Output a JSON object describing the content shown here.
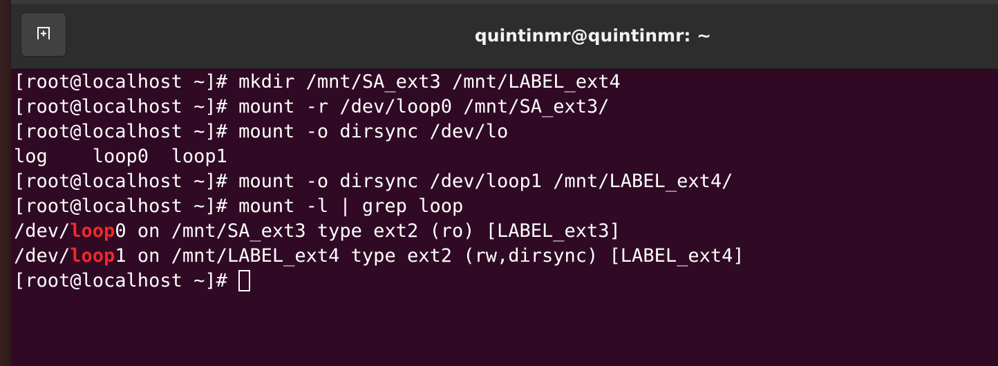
{
  "window": {
    "title": "quintinmr@quintinmr: ~",
    "new_tab_icon": "new-tab-icon"
  },
  "terminal": {
    "prompt": "[root@localhost ~]# ",
    "lines": [
      {
        "type": "command",
        "text": "mkdir /mnt/SA_ext3 /mnt/LABEL_ext4"
      },
      {
        "type": "command",
        "text": "mount -r /dev/loop0 /mnt/SA_ext3/"
      },
      {
        "type": "command",
        "text": "mount -o dirsync /dev/lo"
      },
      {
        "type": "output",
        "text": "log    loop0  loop1"
      },
      {
        "type": "command",
        "text": "mount -o dirsync /dev/loop1 /mnt/LABEL_ext4/"
      },
      {
        "type": "command",
        "text": "mount -l | grep loop"
      },
      {
        "type": "match",
        "before": "/dev/",
        "match": "loop",
        "after": "0 on /mnt/SA_ext3 type ext2 (ro) [LABEL_ext3]"
      },
      {
        "type": "match",
        "before": "/dev/",
        "match": "loop",
        "after": "1 on /mnt/LABEL_ext4 type ext2 (rw,dirsync) [LABEL_ext4]"
      },
      {
        "type": "current",
        "text": ""
      }
    ],
    "colors": {
      "background": "#300a24",
      "text": "#ffffff",
      "grep_highlight": "#ef2929"
    }
  }
}
